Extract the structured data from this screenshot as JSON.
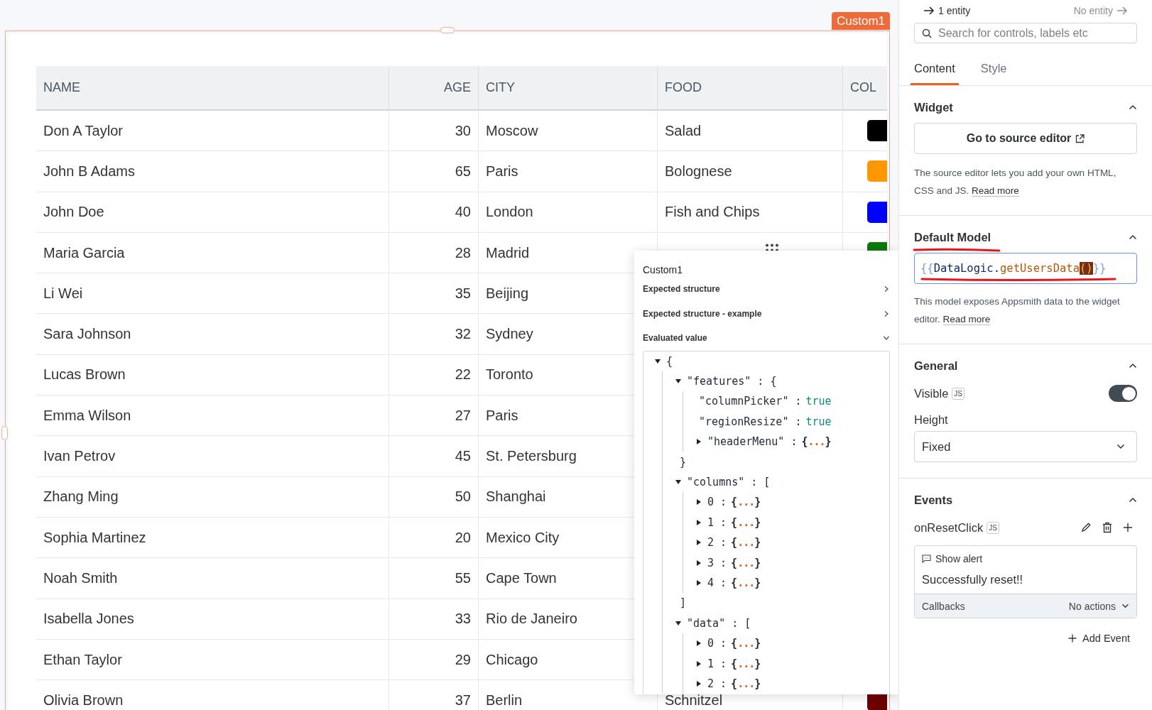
{
  "canvas": {
    "widget_tag": "Custom1",
    "table": {
      "columns": [
        {
          "label": "NAME"
        },
        {
          "label": "AGE"
        },
        {
          "label": "CITY"
        },
        {
          "label": "FOOD"
        },
        {
          "label": "COL"
        }
      ],
      "rows": [
        {
          "name": "Don A Taylor",
          "age": "30",
          "city": "Moscow",
          "food": "Salad",
          "color": "#000000"
        },
        {
          "name": "John B Adams",
          "age": "65",
          "city": "Paris",
          "food": "Bolognese",
          "color": "#ff9800"
        },
        {
          "name": "John Doe",
          "age": "40",
          "city": "London",
          "food": "Fish and Chips",
          "color": "#0000ff"
        },
        {
          "name": "Maria Garcia",
          "age": "28",
          "city": "Madrid",
          "color": "#0b7a0b"
        },
        {
          "name": "Li Wei",
          "age": "35",
          "city": "Beijing"
        },
        {
          "name": "Sara Johnson",
          "age": "32",
          "city": "Sydney"
        },
        {
          "name": "Lucas Brown",
          "age": "22",
          "city": "Toronto"
        },
        {
          "name": "Emma Wilson",
          "age": "27",
          "city": "Paris"
        },
        {
          "name": "Ivan Petrov",
          "age": "45",
          "city": "St. Petersburg"
        },
        {
          "name": "Zhang Ming",
          "age": "50",
          "city": "Shanghai"
        },
        {
          "name": "Sophia Martinez",
          "age": "20",
          "city": "Mexico City"
        },
        {
          "name": "Noah Smith",
          "age": "55",
          "city": "Cape Town"
        },
        {
          "name": "Isabella Jones",
          "age": "33",
          "city": "Rio de Janeiro"
        },
        {
          "name": "Ethan Taylor",
          "age": "29",
          "city": "Chicago"
        },
        {
          "name": "Olivia Brown",
          "age": "37",
          "city": "Berlin",
          "food": "Schnitzel",
          "color": "#6e0000"
        }
      ]
    }
  },
  "popup": {
    "title": "Custom1",
    "sections": [
      {
        "label": "Expected structure",
        "expanded": false
      },
      {
        "label": "Expected structure - example",
        "expanded": false
      },
      {
        "label": "Evaluated value",
        "expanded": true
      }
    ],
    "tree": {
      "kind": "branch",
      "label": "{",
      "expanded": true,
      "children": [
        {
          "kind": "branch",
          "label": "\"features\" : {",
          "expanded": true,
          "close": "}",
          "children": [
            {
              "kind": "leaf",
              "label": "\"columnPicker\" :",
              "value": "true"
            },
            {
              "kind": "leaf",
              "label": "\"regionResize\" :",
              "value": "true"
            },
            {
              "kind": "collapsed",
              "label": "\"headerMenu\" :",
              "expanded": false,
              "open": "{",
              "dots": "...",
              "close": "}"
            }
          ]
        },
        {
          "kind": "branch",
          "label": "\"columns\" : [",
          "expanded": true,
          "close": "]",
          "children": [
            {
              "kind": "collapsed",
              "label": "0 :",
              "expanded": false,
              "open": "{",
              "dots": "...",
              "close": "}"
            },
            {
              "kind": "collapsed",
              "label": "1 :",
              "expanded": false,
              "open": "{",
              "dots": "...",
              "close": "}"
            },
            {
              "kind": "collapsed",
              "label": "2 :",
              "expanded": false,
              "open": "{",
              "dots": "...",
              "close": "}"
            },
            {
              "kind": "collapsed",
              "label": "3 :",
              "expanded": false,
              "open": "{",
              "dots": "...",
              "close": "}"
            },
            {
              "kind": "collapsed",
              "label": "4 :",
              "expanded": false,
              "open": "{",
              "dots": "...",
              "close": "}"
            }
          ]
        },
        {
          "kind": "branch",
          "label": "\"data\" : [",
          "expanded": true,
          "children": [
            {
              "kind": "collapsed",
              "label": "0 :",
              "expanded": false,
              "open": "{",
              "dots": "...",
              "close": "}"
            },
            {
              "kind": "collapsed",
              "label": "1 :",
              "expanded": false,
              "open": "{",
              "dots": "...",
              "close": "}"
            },
            {
              "kind": "collapsed",
              "label": "2 :",
              "expanded": false,
              "open": "{",
              "dots": "...",
              "close": "}"
            }
          ]
        }
      ]
    }
  },
  "panel": {
    "entity_nav": {
      "back": "1 entity",
      "forward": "No entity"
    },
    "search": {
      "placeholder": "Search for controls, labels etc"
    },
    "tabs": [
      {
        "label": "Content",
        "selected": true
      },
      {
        "label": "Style",
        "selected": false
      }
    ],
    "widget": {
      "title": "Widget",
      "expanded": true,
      "button": "Go to source editor",
      "description": "The source editor lets you add your own HTML, CSS and JS.",
      "link": "Read more"
    },
    "default_model": {
      "title": "Default Model",
      "expanded": true,
      "code": [
        {
          "text": "{{",
          "kind": "brace"
        },
        {
          "text": "DataLogic",
          "kind": "object"
        },
        {
          "text": ".",
          "kind": "punct"
        },
        {
          "text": "getUsersData",
          "kind": "method"
        },
        {
          "text": "()",
          "kind": "paren"
        },
        {
          "text": "}}",
          "kind": "brace"
        }
      ],
      "description": "This model exposes Appsmith data to the widget editor.",
      "link": "Read more"
    },
    "general": {
      "title": "General",
      "expanded": true,
      "visible": {
        "label": "Visible",
        "badge": "JS",
        "on": true
      },
      "height": {
        "label": "Height",
        "value": "Fixed"
      }
    },
    "events": {
      "title": "Events",
      "expanded": true,
      "event": {
        "name": "onResetClick",
        "badge": "JS"
      },
      "action": {
        "type": "Show alert",
        "message": "Successfully reset!!",
        "callbacks": "Callbacks",
        "callbacks_value": "No actions"
      },
      "add": "Add Event"
    }
  }
}
